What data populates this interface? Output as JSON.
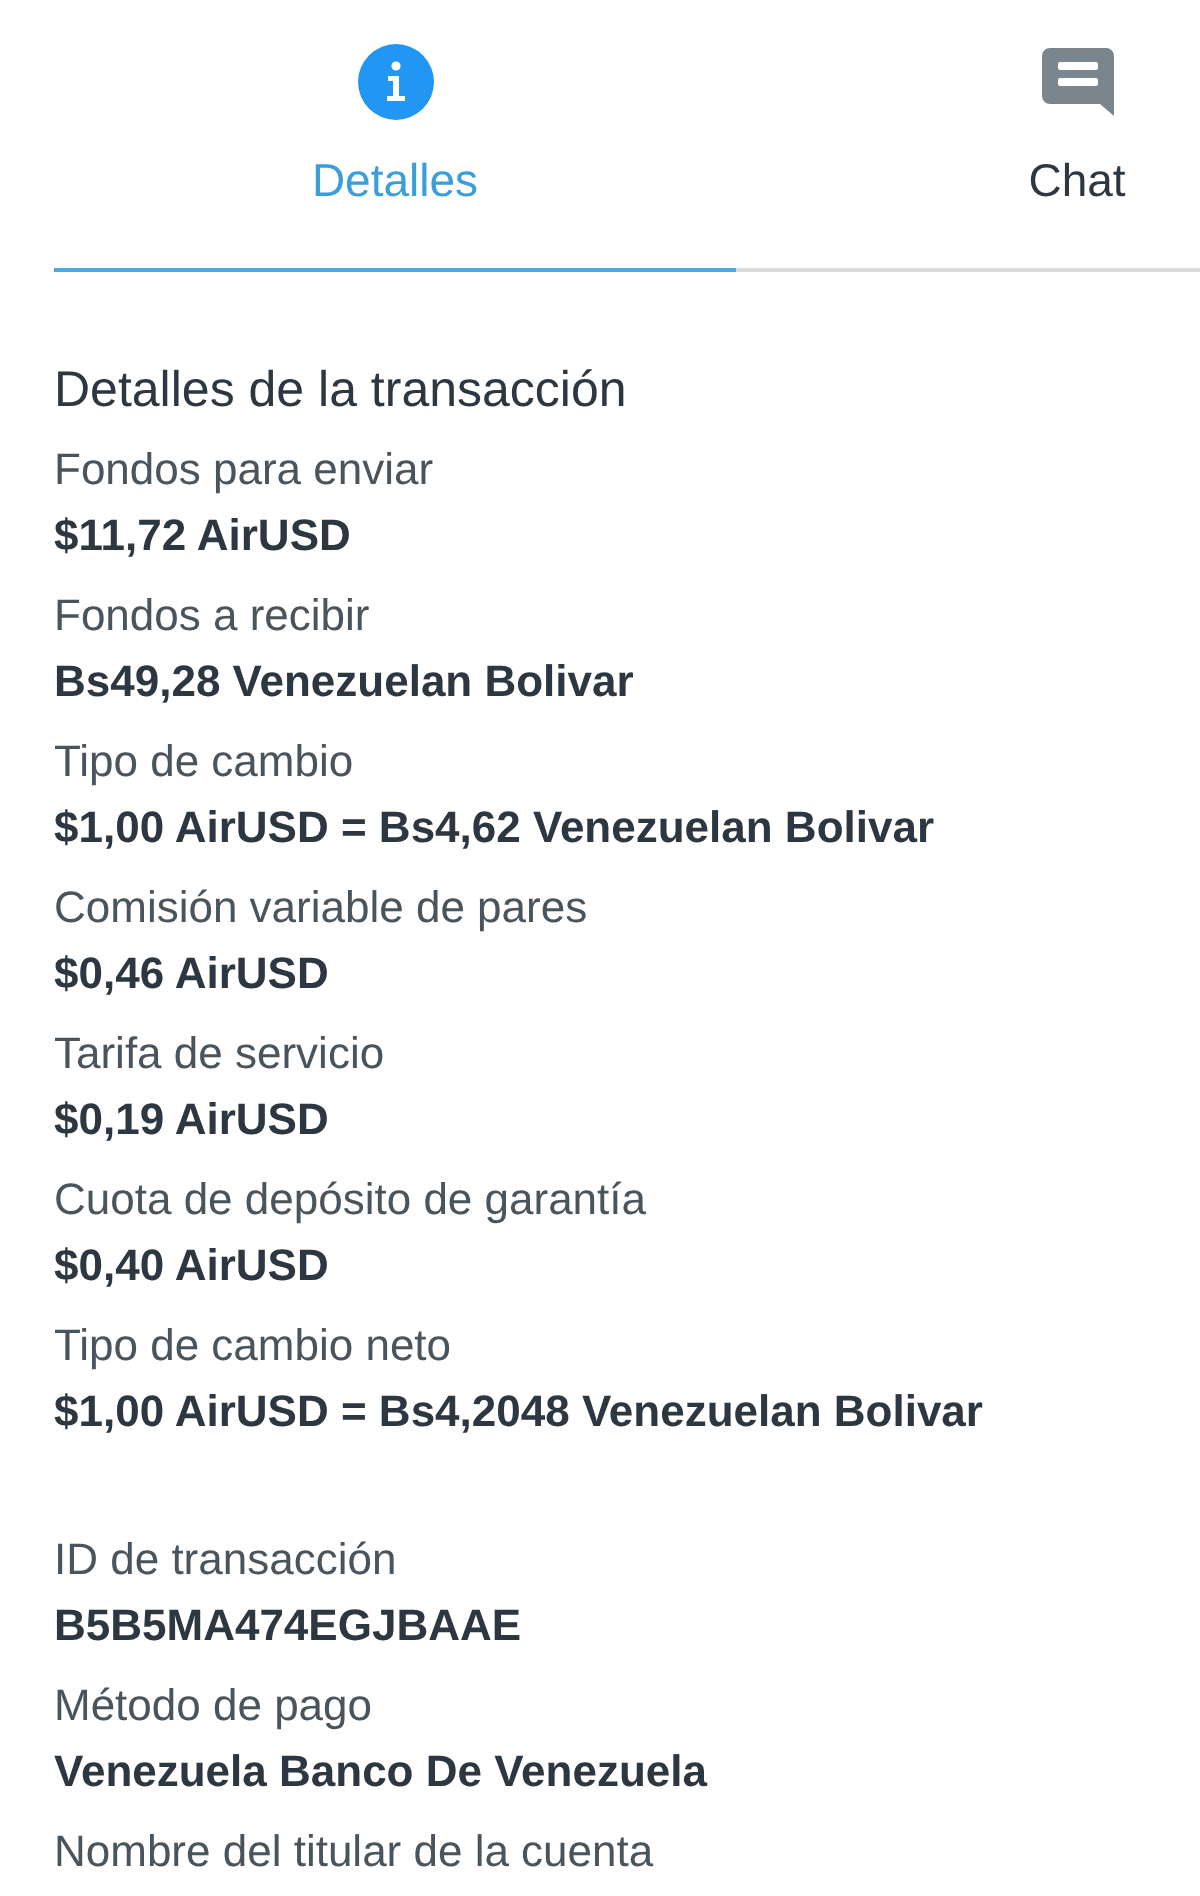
{
  "tabs": [
    {
      "label": "Detalles",
      "kind": "info",
      "selected": true
    },
    {
      "label": "Chat",
      "kind": "chat",
      "selected": false
    }
  ],
  "sections": [
    {
      "title": "Detalles de la transacción",
      "fields": [
        {
          "label": "Fondos para enviar",
          "value": "$11,72 AirUSD"
        },
        {
          "label": "Fondos a recibir",
          "value": "Bs49,28 Venezuelan Bolivar"
        },
        {
          "label": "Tipo de cambio",
          "value": "$1,00 AirUSD = Bs4,62 Venezuelan Bolivar"
        },
        {
          "label": "Comisión variable de pares",
          "value": "$0,46 AirUSD"
        },
        {
          "label": "Tarifa de servicio",
          "value": "$0,19 AirUSD"
        },
        {
          "label": "Cuota de depósito de garantía",
          "value": "$0,40 AirUSD"
        },
        {
          "label": "Tipo de cambio neto",
          "value": "$1,00 AirUSD = Bs4,2048 Venezuelan Bolivar"
        }
      ]
    },
    {
      "fields": [
        {
          "label": "ID de transacción",
          "value": "B5B5MA474EGJBAAE"
        },
        {
          "label": "Método de pago",
          "value": "Venezuela Banco De Venezuela"
        },
        {
          "label": "Nombre del titular de la cuenta"
        }
      ]
    }
  ]
}
